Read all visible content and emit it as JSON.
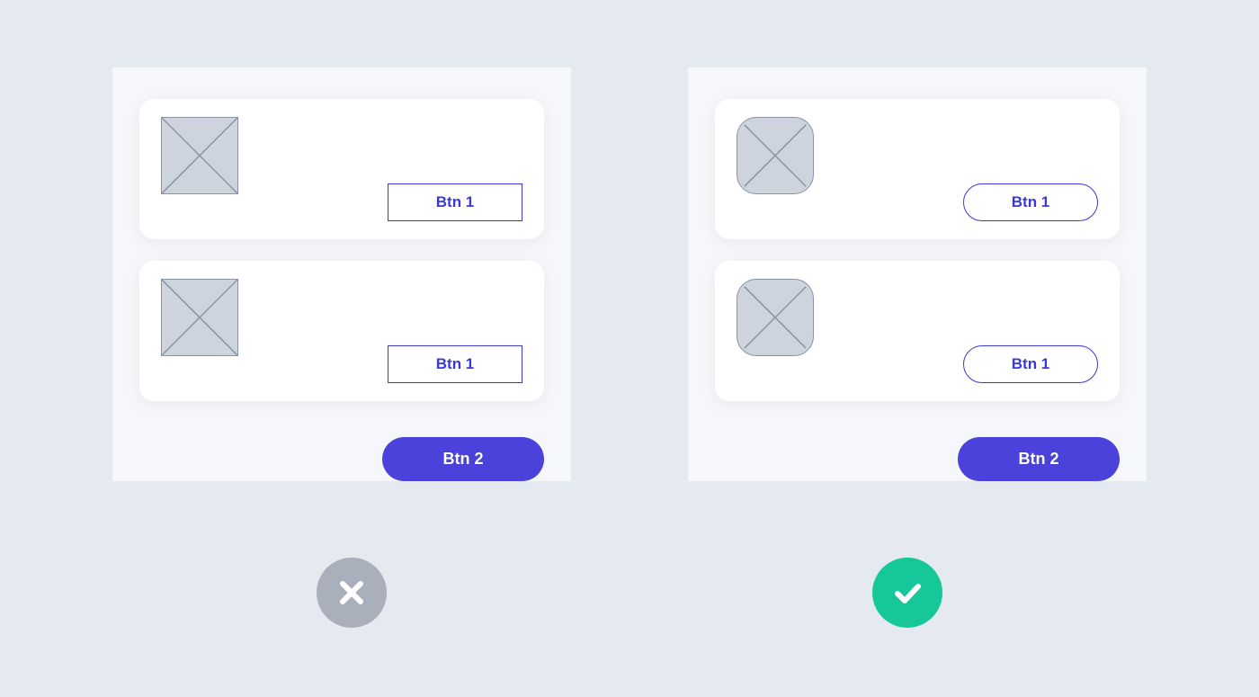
{
  "colors": {
    "background": "#E5E9F0",
    "panel": "#F6F7FA",
    "card": "#FFFFFF",
    "placeholder_fill": "#CED4DE",
    "placeholder_stroke": "#8A92A6",
    "primary": "#4A42DB",
    "outline": "#3B38D9",
    "badge_bad": "#A9B0BB",
    "badge_good": "#16C799"
  },
  "badExample": {
    "cards": [
      {
        "buttonLabel": "Btn 1"
      },
      {
        "buttonLabel": "Btn 1"
      }
    ],
    "footerButtonLabel": "Btn 2"
  },
  "goodExample": {
    "cards": [
      {
        "buttonLabel": "Btn 1"
      },
      {
        "buttonLabel": "Btn 1"
      }
    ],
    "footerButtonLabel": "Btn 2"
  }
}
